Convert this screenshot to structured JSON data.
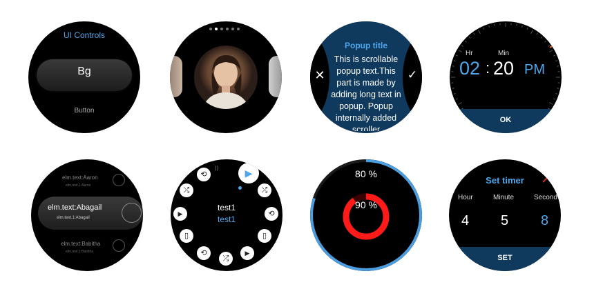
{
  "colors": {
    "accent": "#4fa6ea",
    "popup_bg": "#0f3a5e",
    "ring_red": "#ff1a1a",
    "ring_blue": "#4a9ee0",
    "orange": "#f26b2b"
  },
  "ui_controls": {
    "title": "UI Controls",
    "bg_label": "Bg",
    "button_label": "Button"
  },
  "carousel": {
    "page_count": 6,
    "active_index": 1,
    "image": "portrait-photo"
  },
  "popup": {
    "title": "Popup title",
    "text": "This is scrollable popup text.This part is made by adding long text in popup. Popup internally added scroller",
    "cancel_icon": "close-icon",
    "ok_icon": "check-icon"
  },
  "time_picker": {
    "hr_label": "Hr",
    "min_label": "Min",
    "hour": "02",
    "separator": ":",
    "minute": "20",
    "ampm": "PM",
    "ok_label": "OK"
  },
  "list": {
    "items": [
      {
        "title": "elm.text:Aaron",
        "sub": "elm.text.1:Aaron"
      },
      {
        "title": "elm.text:Abagail",
        "sub": "elm.text.1:Abagail"
      },
      {
        "title": "elm.text:Babitha",
        "sub": "elm.text.1:Babitha"
      }
    ]
  },
  "radial_menu": {
    "title": "test1",
    "subtitle": "test1"
  },
  "progress": {
    "outer_label": "80 %",
    "inner_label": "90 %",
    "outer_value": 80,
    "inner_value": 90
  },
  "timer": {
    "title": "Set timer",
    "hour_label": "Hour",
    "minute_label": "Minute",
    "second_label": "Second",
    "hour": "4",
    "minute": "5",
    "second": "8",
    "set_label": "SET"
  }
}
